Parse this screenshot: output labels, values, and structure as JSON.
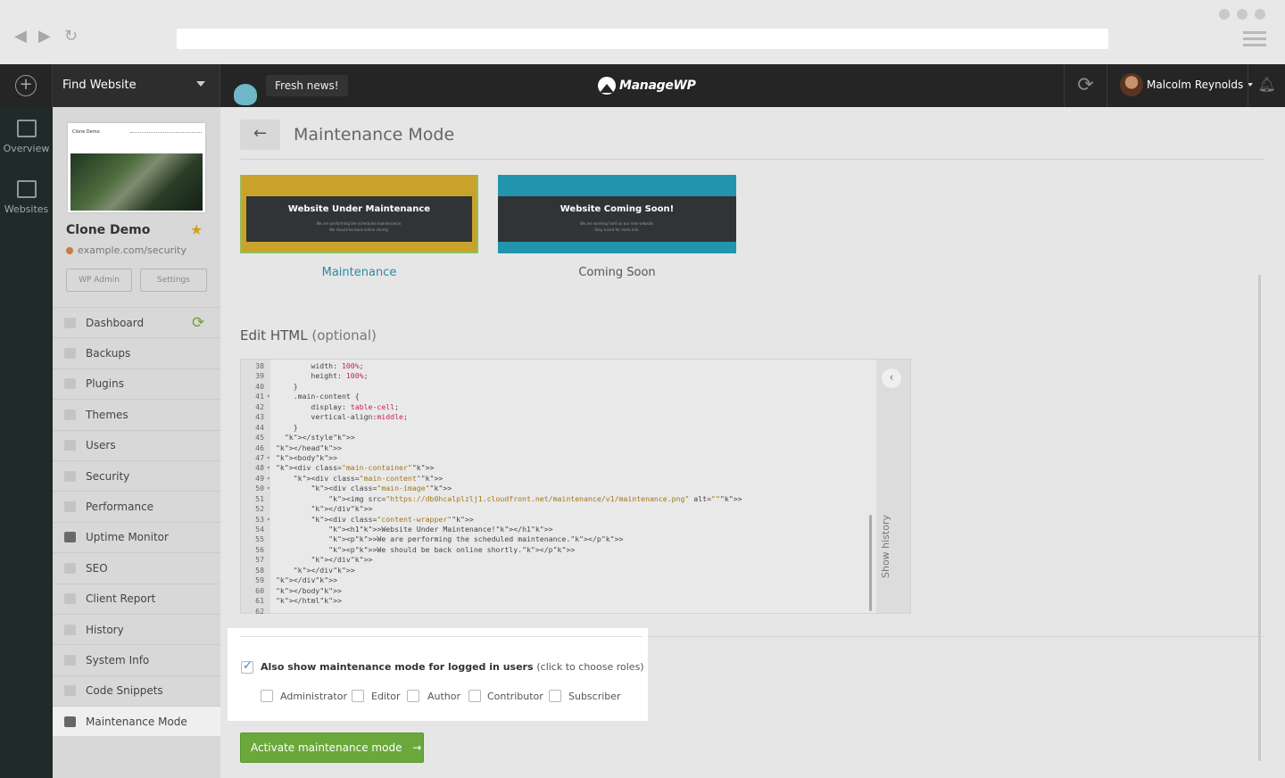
{
  "topbar": {
    "find_website": "Find Website",
    "fresh_news": "Fresh news!",
    "brand": "ManageWP",
    "user_name": "Malcolm Reynolds"
  },
  "rail": [
    {
      "label": "Overview",
      "icon": "monitor-chart-icon"
    },
    {
      "label": "Websites",
      "icon": "stacked-pages-icon"
    }
  ],
  "site": {
    "thumb_title": "Clone Demo",
    "name": "Clone Demo",
    "url": "example.com/security",
    "wp_admin": "WP Admin",
    "settings": "Settings"
  },
  "menu": [
    {
      "label": "Dashboard",
      "icon": "monitor-icon"
    },
    {
      "label": "Backups",
      "icon": "backup-icon"
    },
    {
      "label": "Plugins",
      "icon": "plug-icon"
    },
    {
      "label": "Themes",
      "icon": "palette-icon"
    },
    {
      "label": "Users",
      "icon": "user-icon"
    },
    {
      "label": "Security",
      "icon": "shield-icon"
    },
    {
      "label": "Performance",
      "icon": "gauge-icon"
    },
    {
      "label": "Uptime Monitor",
      "icon": "arrow-up-icon"
    },
    {
      "label": "SEO",
      "icon": "megaphone-icon"
    },
    {
      "label": "Client Report",
      "icon": "chart-icon"
    },
    {
      "label": "History",
      "icon": "clock-icon"
    },
    {
      "label": "System Info",
      "icon": "server-icon"
    },
    {
      "label": "Code Snippets",
      "icon": "code-icon"
    },
    {
      "label": "Maintenance Mode",
      "icon": "barrier-icon"
    }
  ],
  "main": {
    "title": "Maintenance Mode",
    "templates": [
      {
        "heading": "Website Under Maintenance",
        "sub1": "We are performing the scheduled maintenance.",
        "sub2": "We should be back online shortly.",
        "name": "Maintenance"
      },
      {
        "heading": "Website Coming Soon!",
        "sub1": "We are working hard on our new website.",
        "sub2": "Stay tuned for more info.",
        "name": "Coming Soon"
      }
    ],
    "edit_html": "Edit HTML",
    "edit_html_optional": "(optional)",
    "show_history": "Show history",
    "also_show": "Also show maintenance mode for logged in users",
    "also_show_hint": "(click to choose roles)",
    "roles": [
      "Administrator",
      "Editor",
      "Author",
      "Contributor",
      "Subscriber"
    ],
    "activate": "Activate maintenance mode"
  },
  "code_lines": [
    {
      "n": "38",
      "text": "        width: 100%;",
      "fold": ""
    },
    {
      "n": "39",
      "text": "        height: 100%;",
      "fold": ""
    },
    {
      "n": "40",
      "text": "    }",
      "fold": ""
    },
    {
      "n": "41",
      "text": "    .main-content {",
      "fold": "▾"
    },
    {
      "n": "42",
      "text": "        display: table-cell;",
      "fold": ""
    },
    {
      "n": "43",
      "text": "        vertical-align:middle;",
      "fold": ""
    },
    {
      "n": "44",
      "text": "    }",
      "fold": ""
    },
    {
      "n": "45",
      "text": "  </style>",
      "fold": ""
    },
    {
      "n": "46",
      "text": "</head>",
      "fold": ""
    },
    {
      "n": "47",
      "text": "<body>",
      "fold": "▾"
    },
    {
      "n": "48",
      "text": "<div class=\"main-container\">",
      "fold": "▾"
    },
    {
      "n": "49",
      "text": "    <div class=\"main-content\">",
      "fold": "▾"
    },
    {
      "n": "50",
      "text": "        <div class=\"main-image\">",
      "fold": "▾"
    },
    {
      "n": "51",
      "text": "            <img src=\"https://db0hcalplzlj1.cloudfront.net/maintenance/v1/maintenance.png\" alt=\"\">",
      "fold": ""
    },
    {
      "n": "52",
      "text": "        </div>",
      "fold": ""
    },
    {
      "n": "53",
      "text": "        <div class=\"content-wrapper\">",
      "fold": "▾"
    },
    {
      "n": "54",
      "text": "            <h1>Website Under Maintenance!</h1>",
      "fold": ""
    },
    {
      "n": "55",
      "text": "            <p>We are performing the scheduled maintenance.</p>",
      "fold": ""
    },
    {
      "n": "56",
      "text": "            <p>We should be back online shortly.</p>",
      "fold": ""
    },
    {
      "n": "57",
      "text": "        </div>",
      "fold": ""
    },
    {
      "n": "58",
      "text": "    </div>",
      "fold": ""
    },
    {
      "n": "59",
      "text": "</div>",
      "fold": ""
    },
    {
      "n": "60",
      "text": "</body>",
      "fold": ""
    },
    {
      "n": "61",
      "text": "</html>",
      "fold": ""
    },
    {
      "n": "62",
      "text": "",
      "fold": ""
    }
  ],
  "colors": {
    "accent_green": "#6aa83b",
    "link_teal": "#2a8aa6",
    "template_yellow": "#c9a22a",
    "template_teal": "#2295ad"
  }
}
